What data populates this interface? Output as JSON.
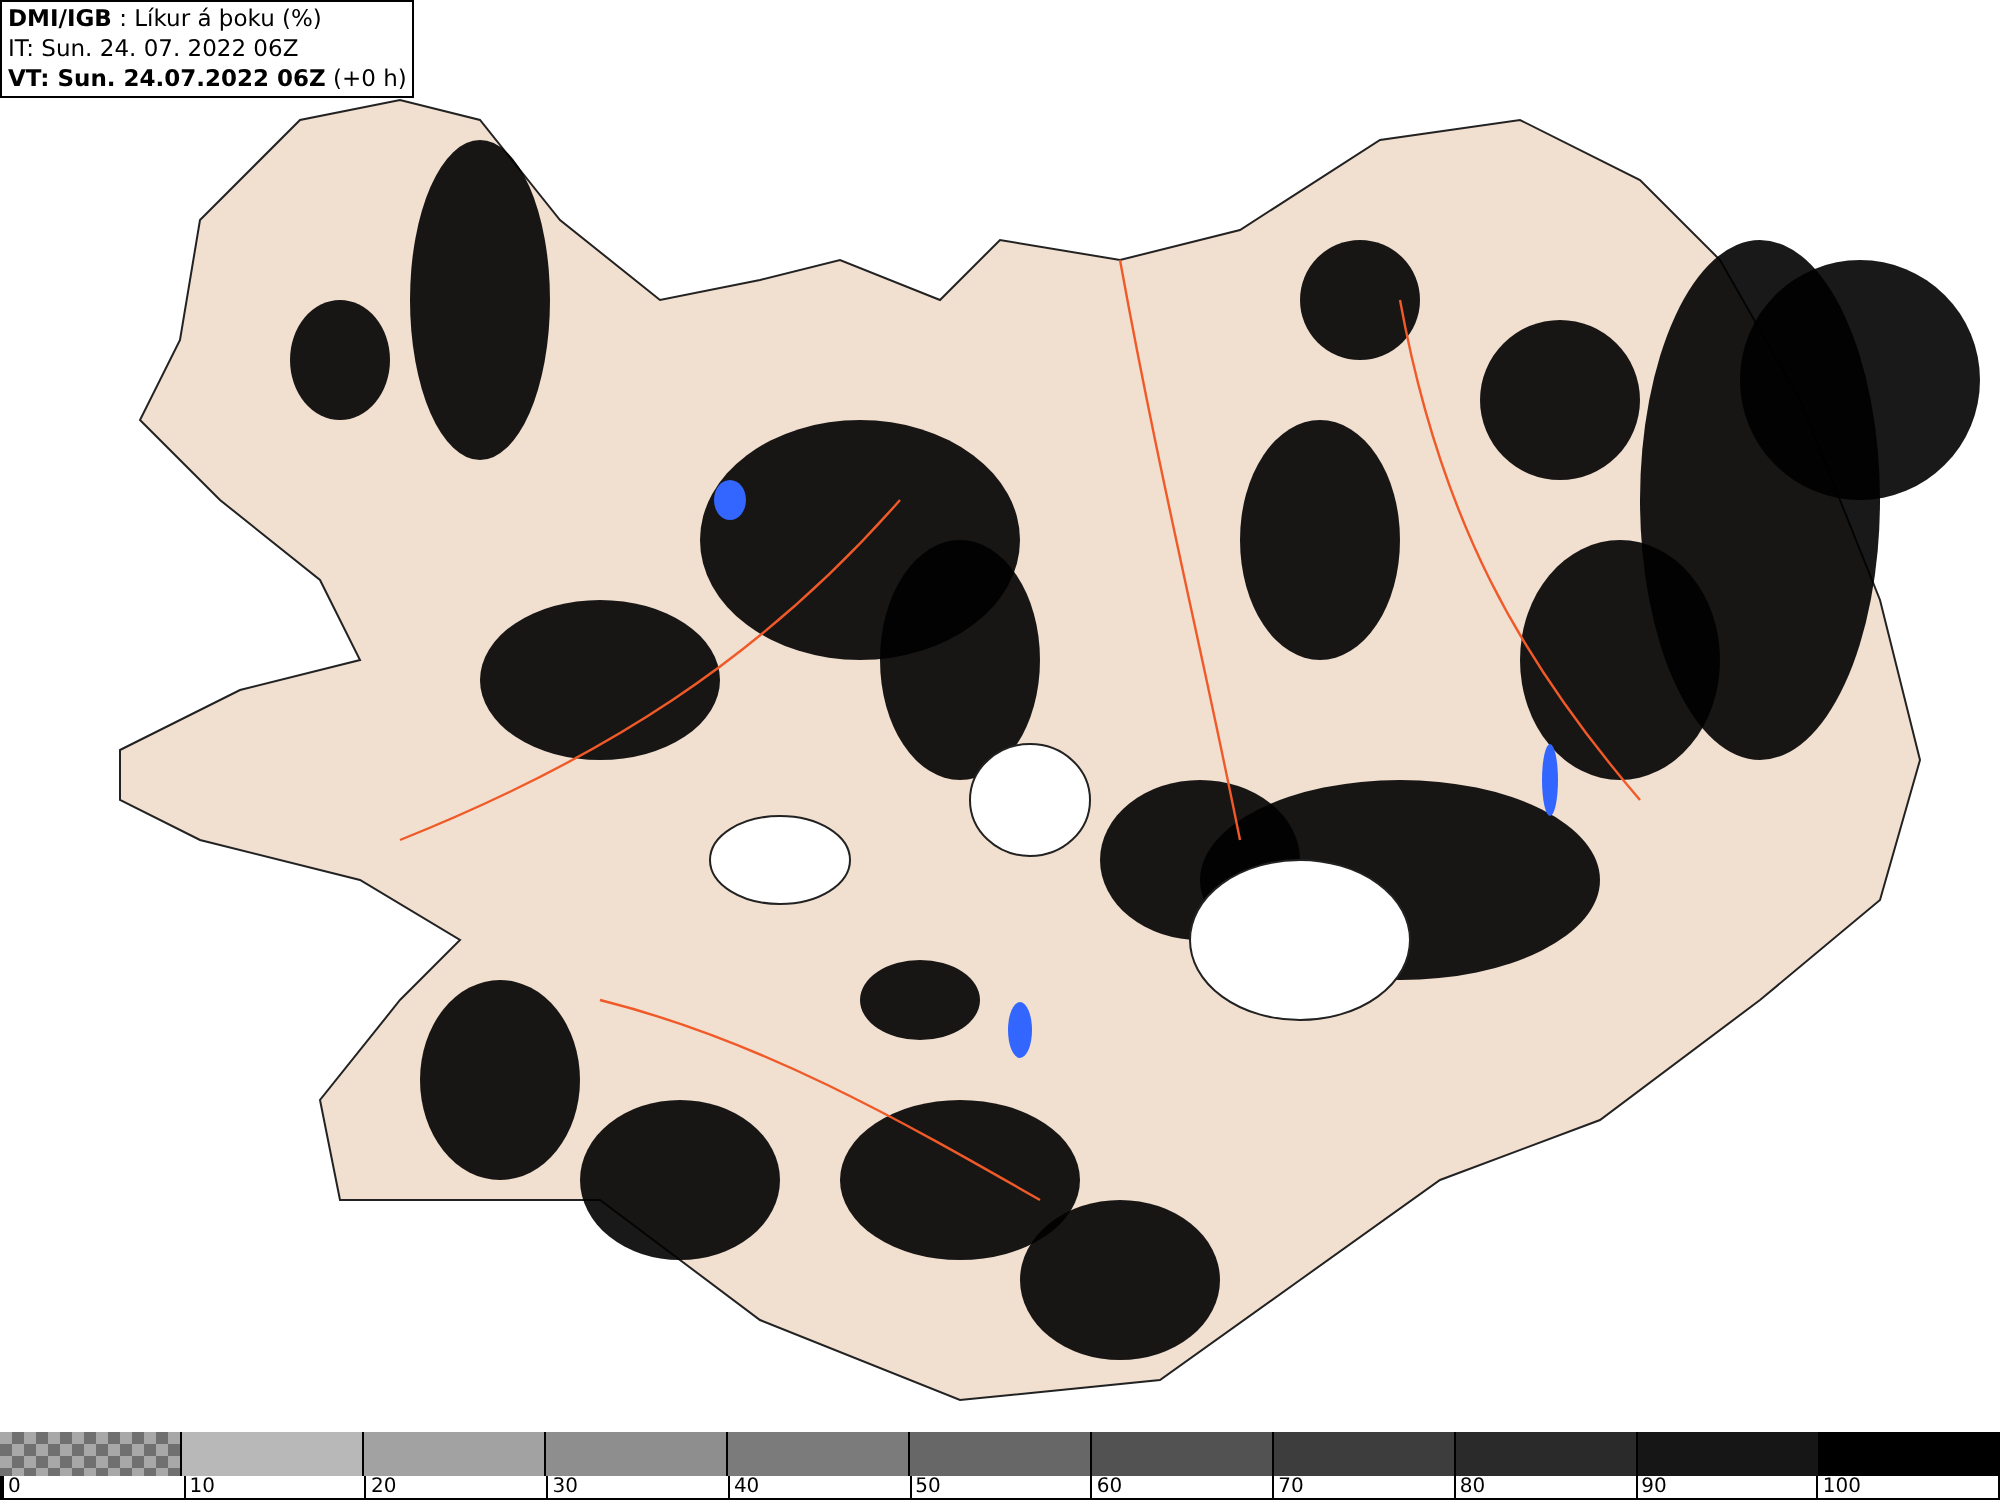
{
  "header": {
    "lines": [
      "**DMI/IGB** : Líkur á þoku (%)",
      "IT: Sun. 24. 07. 2022 06Z",
      "**VT: Sun. 24.07.2022 06Z** (+0 h)"
    ]
  },
  "legend": {
    "segments": [
      {
        "kind": "checker",
        "color": "#707070"
      },
      {
        "kind": "solid",
        "color": "#b8b8b8"
      },
      {
        "kind": "solid",
        "color": "#a2a2a2"
      },
      {
        "kind": "solid",
        "color": "#8e8e8e"
      },
      {
        "kind": "solid",
        "color": "#7b7b7b"
      },
      {
        "kind": "solid",
        "color": "#676767"
      },
      {
        "kind": "solid",
        "color": "#525252"
      },
      {
        "kind": "solid",
        "color": "#3d3d3d"
      },
      {
        "kind": "solid",
        "color": "#2a2a2a"
      },
      {
        "kind": "solid",
        "color": "#161616"
      },
      {
        "kind": "solid",
        "color": "#000000"
      }
    ],
    "ticks": [
      "0",
      "10",
      "20",
      "30",
      "40",
      "50",
      "60",
      "70",
      "80",
      "90",
      "100"
    ]
  }
}
